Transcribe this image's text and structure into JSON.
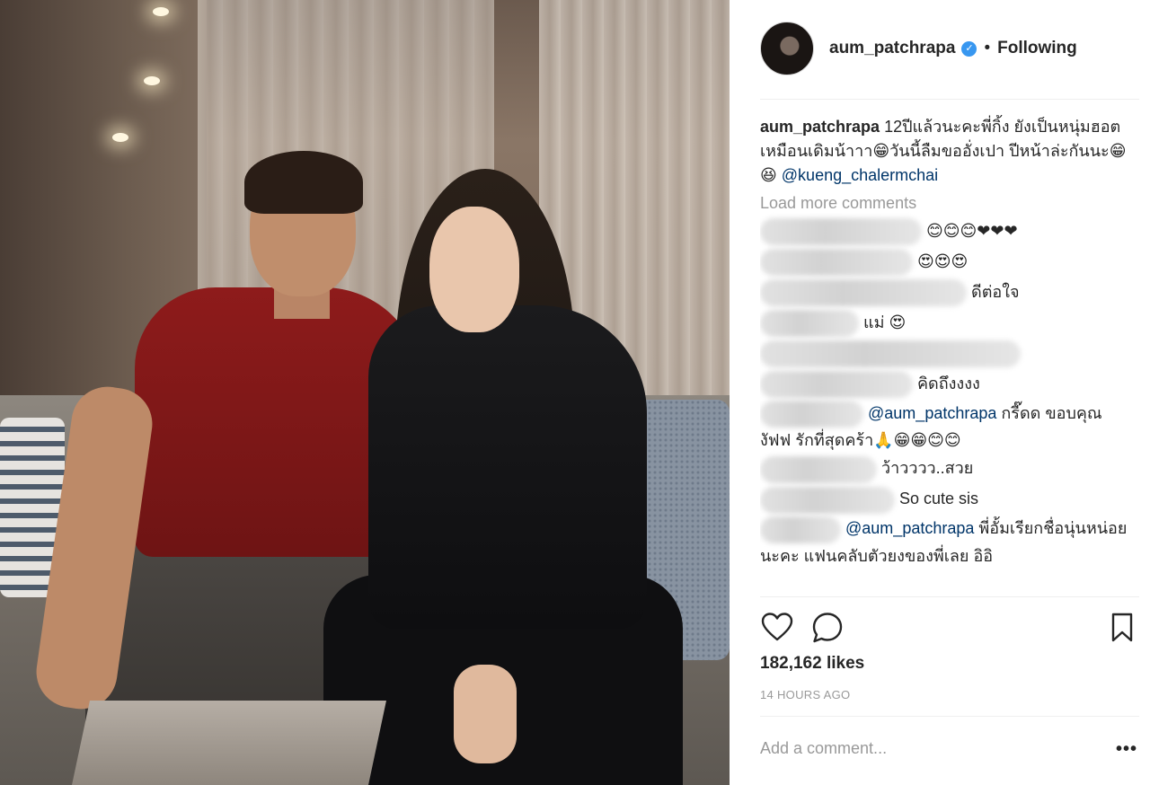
{
  "post": {
    "username": "aum_patchrapa",
    "follow_status": "Following",
    "separator": "•",
    "verified": true
  },
  "caption": {
    "username": "aum_patchrapa",
    "text": "12ปีแล้วนะคะพี่กิ้ง ยังเป็นหนุ่มฮอตเหมือนเดิมน้าาา😁วันนี้ลืมขออั่งเปา ปีหน้าล่ะกันนะ😁😆",
    "mention": "@kueng_chalermchai"
  },
  "load_more": "Load more comments",
  "comments": [
    {
      "text": "😊😊😊❤❤❤"
    },
    {
      "text": "😍😍😍"
    },
    {
      "text": "ดีต่อใจ"
    },
    {
      "text": "แม่ 😍"
    },
    {
      "text": ""
    },
    {
      "text": "คิดถึงงงง"
    },
    {
      "mention": "@aum_patchrapa",
      "text": "กรี๊ดด ขอบคุณงัฟฟ รักที่สุดคร้า🙏😁😁😊😊"
    },
    {
      "text": "ว้าวววว..สวย"
    },
    {
      "text": "So cute sis"
    },
    {
      "mention": "@aum_patchrapa",
      "text": "พี่อั้มเรียกชื่อนุ่นหน่อยนะคะ แฟนคลับตัวยงของพี่เลย อิอิ"
    }
  ],
  "likes": "182,162 likes",
  "time_ago": "14 HOURS AGO",
  "add_comment_placeholder": "Add a comment...",
  "more_label": "•••",
  "colors": {
    "verified": "#3897f0",
    "mention": "#003569",
    "muted": "#999999",
    "text": "#262626"
  }
}
